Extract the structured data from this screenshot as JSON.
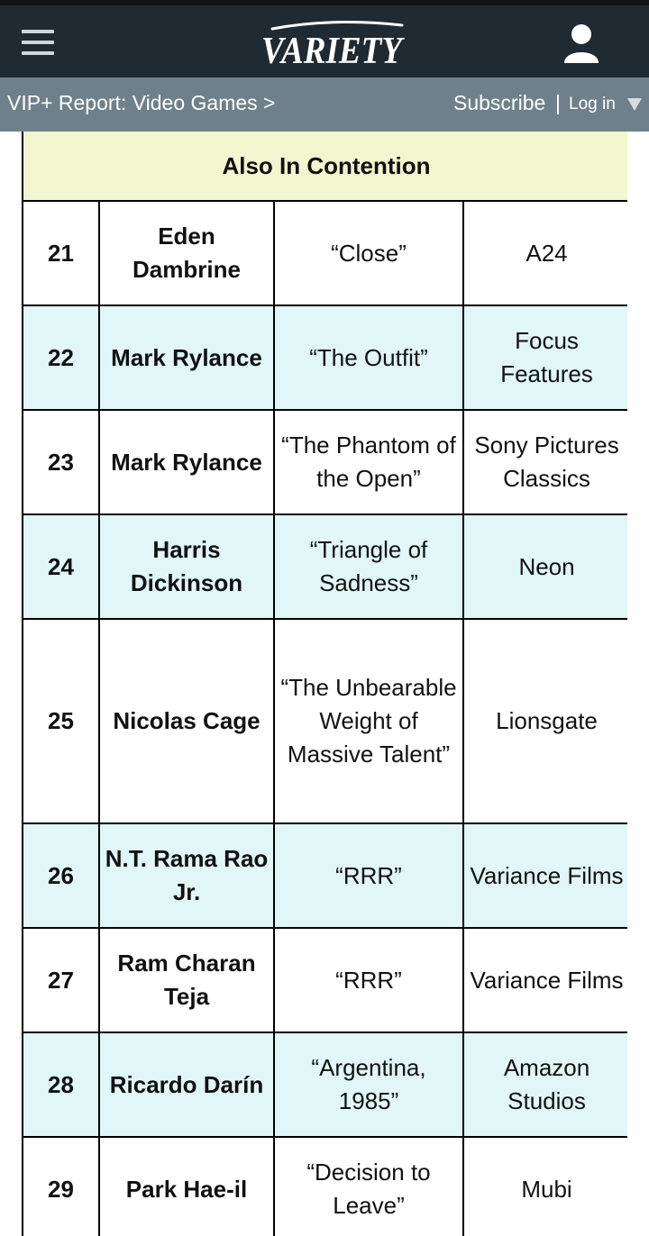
{
  "header": {
    "logo_text": "VARIETY"
  },
  "subnav": {
    "vip_link": "VIP+ Report: Video Games >",
    "subscribe": "Subscribe",
    "separator": "|",
    "login": "Log in"
  },
  "table": {
    "section_title": "Also In Contention",
    "rows": [
      {
        "rank": "21",
        "name": "Eden Dambrine",
        "film": "“Close”",
        "studio": "A24"
      },
      {
        "rank": "22",
        "name": "Mark Rylance",
        "film": "“The Outfit”",
        "studio": "Focus Features"
      },
      {
        "rank": "23",
        "name": "Mark Rylance",
        "film": "“The Phantom of the Open”",
        "studio": "Sony Pictures Classics"
      },
      {
        "rank": "24",
        "name": "Harris Dickinson",
        "film": "“Triangle of Sadness”",
        "studio": "Neon"
      },
      {
        "rank": "25",
        "name": "Nicolas Cage",
        "film": "“The Unbearable Weight of Massive Talent”",
        "studio": "Lionsgate"
      },
      {
        "rank": "26",
        "name": "N.T. Rama Rao Jr.",
        "film": "“RRR”",
        "studio": "Variance Films"
      },
      {
        "rank": "27",
        "name": "Ram Charan Teja",
        "film": "“RRR”",
        "studio": "Variance Films"
      },
      {
        "rank": "28",
        "name": "Ricardo Darín",
        "film": "“Argentina, 1985”",
        "studio": "Amazon Studios"
      },
      {
        "rank": "29",
        "name": "Park Hae-il",
        "film": "“Decision to Leave”",
        "studio": "Mubi"
      }
    ]
  },
  "colors": {
    "header_bg": "#1f2a33",
    "subbar_bg": "#6f808b",
    "section_bg": "#f2f6cf",
    "row_shade": "#e0f6f7"
  },
  "icons": {
    "menu": "hamburger-menu-icon",
    "user": "user-account-icon",
    "dropdown": "caret-down-icon"
  }
}
